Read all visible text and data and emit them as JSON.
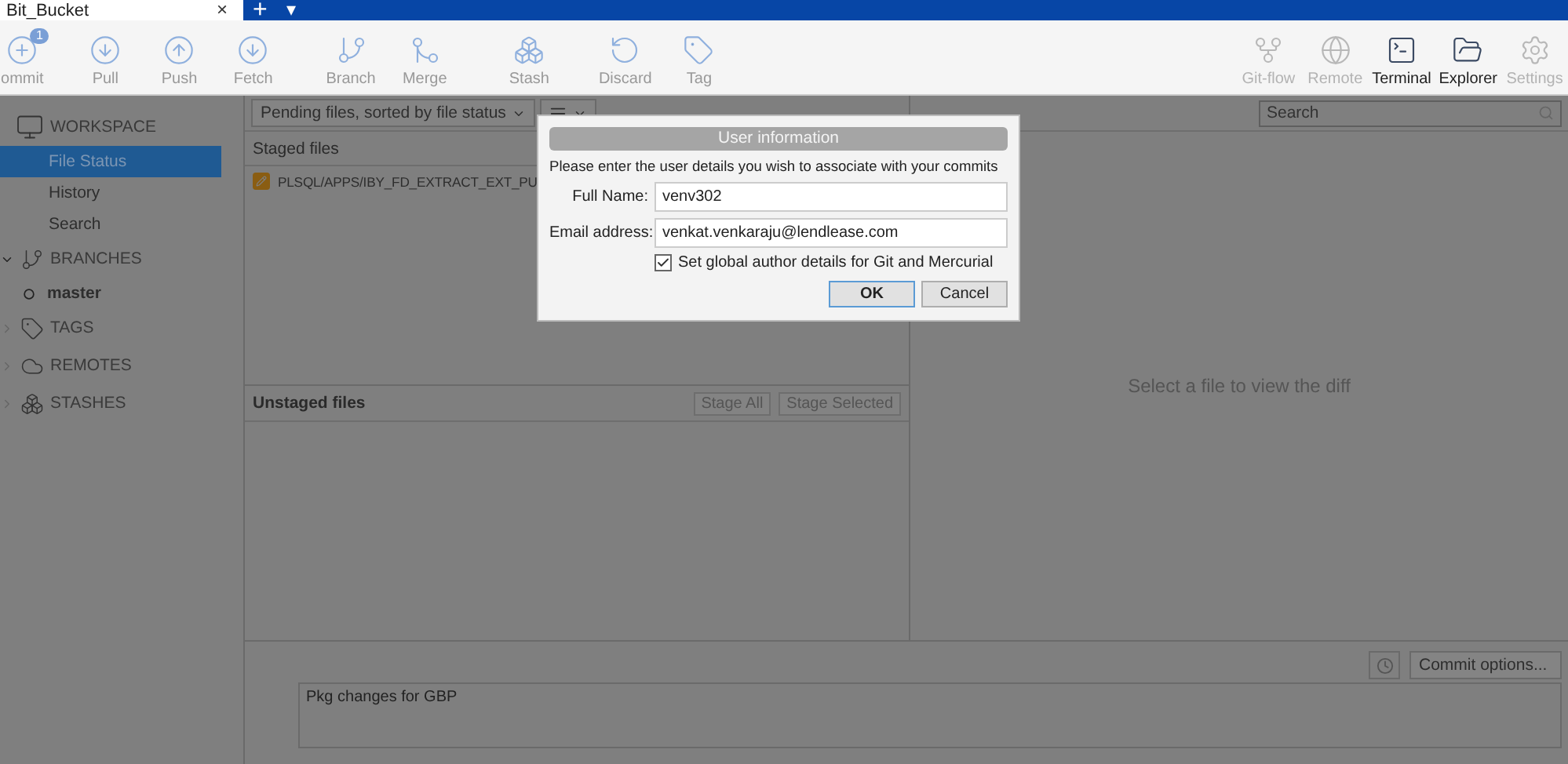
{
  "window": {
    "tab_title": "Bit_Bucket",
    "close": "×",
    "new_tab": "+",
    "tab_menu": "▾"
  },
  "toolbar": [
    {
      "kind": "commit",
      "label": "ommit",
      "badge": "1",
      "disabled": false,
      "emphasis": false
    },
    {
      "kind": "pull",
      "label": "Pull",
      "disabled": false,
      "emphasis": false
    },
    {
      "kind": "push",
      "label": "Push",
      "disabled": false,
      "emphasis": false
    },
    {
      "kind": "fetch",
      "label": "Fetch",
      "disabled": false,
      "emphasis": false
    },
    {
      "kind": "branch",
      "label": "Branch",
      "disabled": false,
      "emphasis": false
    },
    {
      "kind": "merge",
      "label": "Merge",
      "disabled": false,
      "emphasis": false
    },
    {
      "kind": "stash",
      "label": "Stash",
      "disabled": false,
      "emphasis": false
    },
    {
      "kind": "discard",
      "label": "Discard",
      "disabled": false,
      "emphasis": false
    },
    {
      "kind": "tag",
      "label": "Tag",
      "disabled": false,
      "emphasis": false
    },
    {
      "kind": "gitflow",
      "label": "Git-flow",
      "disabled": true,
      "emphasis": false
    },
    {
      "kind": "remote",
      "label": "Remote",
      "disabled": true,
      "emphasis": false
    },
    {
      "kind": "terminal",
      "label": "Terminal",
      "disabled": false,
      "emphasis": true
    },
    {
      "kind": "explorer",
      "label": "Explorer",
      "disabled": false,
      "emphasis": true
    },
    {
      "kind": "settings",
      "label": "Settings",
      "disabled": true,
      "emphasis": false
    }
  ],
  "sidebar": [
    {
      "kind": "workspace",
      "label": "WORKSPACE",
      "expanded": true,
      "children": [
        {
          "label": "File Status",
          "selected": true,
          "current": false
        },
        {
          "label": "History",
          "selected": false,
          "current": false
        },
        {
          "label": "Search",
          "selected": false,
          "current": false
        }
      ]
    },
    {
      "kind": "branches",
      "label": "BRANCHES",
      "expanded": true,
      "children": [
        {
          "label": "master",
          "selected": false,
          "current": true
        }
      ]
    },
    {
      "kind": "tags",
      "label": "TAGS",
      "expanded": false
    },
    {
      "kind": "remotes",
      "label": "REMOTES",
      "expanded": false
    },
    {
      "kind": "stashes",
      "label": "STASHES",
      "expanded": false
    }
  ],
  "file_filter": {
    "value": "Pending files, sorted by file status"
  },
  "staged": {
    "title": "Staged files",
    "files": [
      {
        "path": "PLSQL/APPS/IBY_FD_EXTRACT_EXT_PU"
      }
    ]
  },
  "unstaged": {
    "title": "Unstaged files",
    "buttons": [
      "Stage All",
      "Stage Selected"
    ]
  },
  "search": {
    "placeholder": "Search"
  },
  "diff": {
    "message": "Select a file to view the diff"
  },
  "commit": {
    "options": "Commit options...",
    "message": "Pkg changes for GBP"
  },
  "dialog": {
    "title": "User information",
    "prompt": "Please enter the user details you wish to associate with your commits",
    "fields": [
      {
        "label": "Full Name:",
        "value": "venv302"
      },
      {
        "label": "Email address:",
        "value": "venkat.venkaraju@lendlease.com"
      }
    ],
    "checkbox": {
      "label": "Set global author details for Git and Mercurial",
      "checked": true
    },
    "buttons": [
      {
        "label": "OK",
        "default": true
      },
      {
        "label": "Cancel",
        "default": false
      }
    ]
  }
}
